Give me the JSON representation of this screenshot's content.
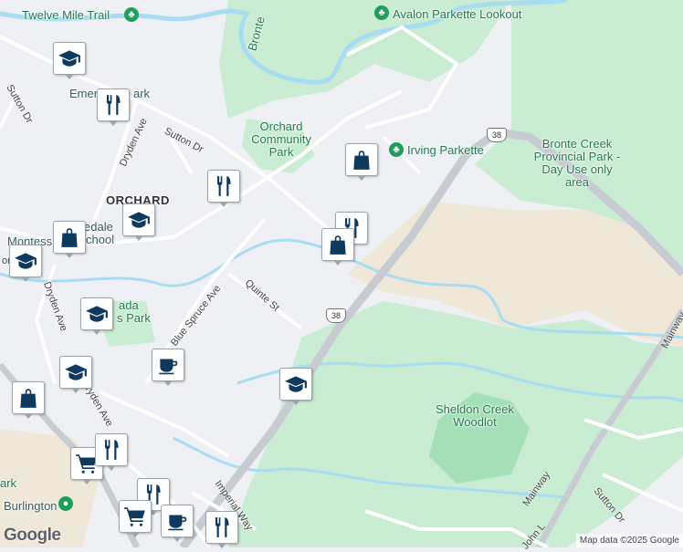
{
  "map": {
    "place_labels": [
      {
        "text": "Twelve Mile Trail",
        "kind": "park"
      },
      {
        "text": "Avalon Parkette Lookout",
        "kind": "park"
      },
      {
        "text": "Irving Parkette",
        "kind": "park"
      },
      {
        "text": "Orchard Community Park",
        "kind": "park"
      },
      {
        "text": "Bronte Creek Provincial Park - Day Use only area",
        "kind": "park"
      },
      {
        "text": "Sheldon Creek Woodlot",
        "kind": "park"
      },
      {
        "text": "ORCHARD",
        "kind": "neighbourhood"
      },
      {
        "text": "Emer",
        "kind": "partial"
      },
      {
        "text": "ark",
        "kind": "partial"
      },
      {
        "text": "Montess",
        "kind": "partial"
      },
      {
        "text": "edale",
        "kind": "partial"
      },
      {
        "text": "chool",
        "kind": "partial"
      },
      {
        "text": "ada",
        "kind": "partial"
      },
      {
        "text": "s Park",
        "kind": "partial"
      },
      {
        "text": "ark",
        "kind": "partial"
      },
      {
        "text": "Burlington",
        "kind": "partial"
      },
      {
        "text": "Bronte",
        "kind": "partial"
      }
    ],
    "streets": [
      "Sutton Dr",
      "Dryden Ave",
      "Sutton Dr",
      "Quinte St",
      "Blue Spruce Ave",
      "Dryden Ave",
      "Imperial Way",
      "Mainway",
      "Sutton Dr",
      "John L",
      "Mainway",
      "Dryden Ave",
      "on Dr"
    ],
    "highway_shields": [
      "38",
      "38"
    ],
    "poi_icons": [
      "school-icon",
      "restaurant-icon",
      "shopping-bag-icon",
      "restaurant-icon",
      "shopping-bag-icon",
      "restaurant-icon",
      "shopping-bag-icon",
      "school-icon",
      "school-icon",
      "school-icon",
      "school-icon",
      "cafe-icon",
      "school-icon",
      "shopping-bag-icon",
      "shopping-cart-icon",
      "restaurant-icon",
      "restaurant-icon",
      "shopping-cart-icon",
      "cafe-icon",
      "restaurant-icon"
    ],
    "colors": {
      "background": "#eef0f3",
      "park": "#c9ecd2",
      "forest": "#a5dfb7",
      "industrial": "#efe8d8",
      "water": "#a8dcf0",
      "highway": "#c8ccd2",
      "road": "#ffffff",
      "icon": "#0f3a5e"
    }
  },
  "logo": "Google",
  "attribution": "Map data ©2025 Google"
}
